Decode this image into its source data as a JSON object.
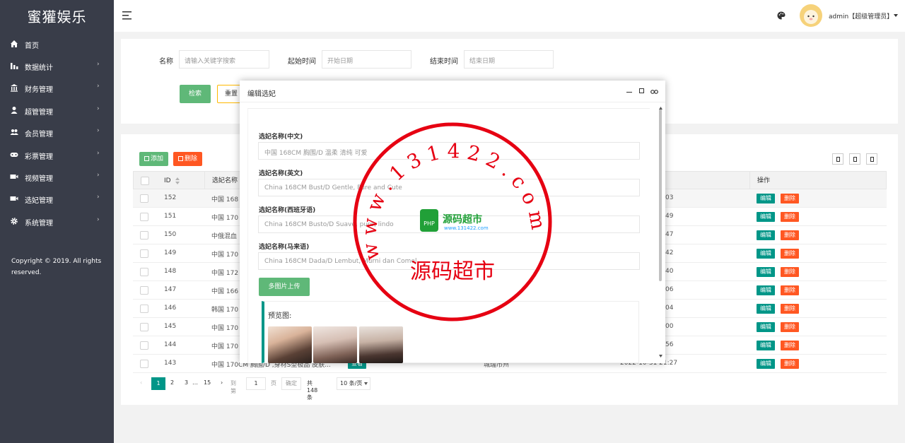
{
  "sidebar": {
    "logo": "蜜獾娱乐",
    "items": [
      {
        "label": "首页",
        "icon": "home-icon",
        "chevron": ""
      },
      {
        "label": "数据统计",
        "icon": "bar-chart-icon",
        "chevron": "›"
      },
      {
        "label": "财务管理",
        "icon": "bank-icon",
        "chevron": "›"
      },
      {
        "label": "超管管理",
        "icon": "user-icon",
        "chevron": "›"
      },
      {
        "label": "会员管理",
        "icon": "users-icon",
        "chevron": "›"
      },
      {
        "label": "彩票管理",
        "icon": "gamepad-icon",
        "chevron": "›"
      },
      {
        "label": "视频管理",
        "icon": "video-icon",
        "chevron": "›"
      },
      {
        "label": "选妃管理",
        "icon": "video-icon",
        "chevron": "›"
      },
      {
        "label": "系统管理",
        "icon": "gear-icon",
        "chevron": "›"
      }
    ],
    "copyright": "Copyright © 2019. All rights reserved."
  },
  "header": {
    "user": "admin【超级管理员】"
  },
  "search": {
    "name_label": "名称",
    "name_placeholder": "请输入关键字搜索",
    "start_label": "起始时间",
    "start_placeholder": "开始日期",
    "end_label": "结束时间",
    "end_placeholder": "结束日期",
    "search_button": "检索",
    "reset_button": "重置"
  },
  "toolbar": {
    "add_button": "添加",
    "delete_button": "删除"
  },
  "table": {
    "columns": {
      "id": "ID",
      "name": "选妃名称",
      "op": "操作"
    },
    "edit_label": "编辑",
    "delete_label": "删除",
    "rows": [
      {
        "id": "152",
        "name": "中国 168",
        "time": "03"
      },
      {
        "id": "151",
        "name": "中国 170",
        "time": "49"
      },
      {
        "id": "150",
        "name": "中俄混血",
        "time": "47"
      },
      {
        "id": "149",
        "name": "中国 170",
        "time": "42"
      },
      {
        "id": "148",
        "name": "中国 172",
        "time": "40"
      },
      {
        "id": "147",
        "name": "中国 166",
        "time": "06"
      },
      {
        "id": "146",
        "name": "韩国 170",
        "time": "04"
      },
      {
        "id": "145",
        "name": "中国 170",
        "time": "00"
      },
      {
        "id": "144",
        "name": "中国 170",
        "time": "56"
      },
      {
        "id": "143",
        "name": "中国 170CM 胸围/D ,身材S型极品 皮肤...",
        "status": "查看",
        "city": "城瑞市州",
        "time": "2022-10-31 21:27"
      }
    ]
  },
  "pagination": {
    "prev": "‹",
    "pages": [
      "1",
      "2",
      "3",
      "…",
      "15"
    ],
    "next": "›",
    "goto_label": "到第",
    "goto_value": "1",
    "page_unit": "页",
    "confirm": "确定",
    "total": "共 148 条",
    "per_page": "10 条/页"
  },
  "modal": {
    "title": "编辑选妃",
    "fields": [
      {
        "label": "选妃名称(中文)",
        "value": "中国   168CM  胸围/D   温柔  清纯  可爱"
      },
      {
        "label": "选妃名称(英文)",
        "value": "China 168CM Bust/D Gentle, Pure and Cute"
      },
      {
        "label": "选妃名称(西班牙语)",
        "value": "China 168CM Busto/D Suave, puro, lindo"
      },
      {
        "label": "选妃名称(马来语)",
        "value": "China 168CM Dada/D Lembut, Murni dan Comel"
      }
    ],
    "upload_button": "多图片上传",
    "preview_label": "预览图:"
  },
  "watermark": {
    "ring_text": "w w w . 1 3 1 4 2 2 . c o m",
    "center_text": "源码超市",
    "badge_text": "PHP",
    "brand_text": "源码超市",
    "brand_url": "www.131422.com"
  },
  "colors": {
    "sidebar": "#393d49",
    "primary": "#5fb878",
    "teal": "#009688",
    "danger": "#ff5722",
    "accent": "#1e9fff",
    "stamp": "#e60012"
  }
}
